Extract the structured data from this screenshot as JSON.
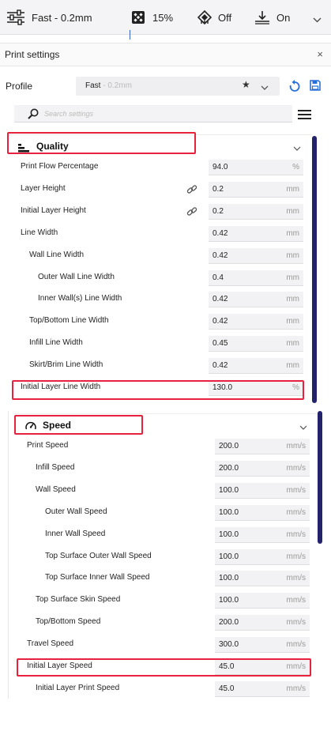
{
  "topbar": {
    "profile": "Fast - 0.2mm",
    "infill": "15%",
    "support": "Off",
    "adhesion": "On"
  },
  "print_settings": {
    "title": "Print settings",
    "close": "×",
    "profile_label": "Profile",
    "profile_name": "Fast",
    "profile_variant": " - 0.2mm",
    "search_placeholder": "Search settings"
  },
  "quality": {
    "title": "Quality",
    "rows": [
      {
        "label": "Print Flow Percentage",
        "value": "94.0",
        "unit": "%"
      },
      {
        "label": "Layer Height",
        "value": "0.2",
        "unit": "mm"
      },
      {
        "label": "Initial Layer Height",
        "value": "0.2",
        "unit": "mm"
      },
      {
        "label": "Line Width",
        "value": "0.42",
        "unit": "mm"
      },
      {
        "label": "Wall Line Width",
        "value": "0.42",
        "unit": "mm"
      },
      {
        "label": "Outer Wall Line Width",
        "value": "0.4",
        "unit": "mm"
      },
      {
        "label": "Inner Wall(s) Line Width",
        "value": "0.42",
        "unit": "mm"
      },
      {
        "label": "Top/Bottom Line Width",
        "value": "0.42",
        "unit": "mm"
      },
      {
        "label": "Infill Line Width",
        "value": "0.45",
        "unit": "mm"
      },
      {
        "label": "Skirt/Brim Line Width",
        "value": "0.42",
        "unit": "mm"
      },
      {
        "label": "Initial Layer Line Width",
        "value": "130.0",
        "unit": "%"
      }
    ]
  },
  "speed": {
    "title": "Speed",
    "rows": [
      {
        "label": "Print Speed",
        "value": "200.0",
        "unit": "mm/s"
      },
      {
        "label": "Infill Speed",
        "value": "200.0",
        "unit": "mm/s"
      },
      {
        "label": "Wall Speed",
        "value": "100.0",
        "unit": "mm/s"
      },
      {
        "label": "Outer Wall Speed",
        "value": "100.0",
        "unit": "mm/s"
      },
      {
        "label": "Inner Wall Speed",
        "value": "100.0",
        "unit": "mm/s"
      },
      {
        "label": "Top Surface Outer Wall Speed",
        "value": "100.0",
        "unit": "mm/s"
      },
      {
        "label": "Top Surface Inner Wall Speed",
        "value": "100.0",
        "unit": "mm/s"
      },
      {
        "label": "Top Surface Skin Speed",
        "value": "100.0",
        "unit": "mm/s"
      },
      {
        "label": "Top/Bottom Speed",
        "value": "200.0",
        "unit": "mm/s"
      },
      {
        "label": "Travel Speed",
        "value": "300.0",
        "unit": "mm/s"
      },
      {
        "label": "Initial Layer Speed",
        "value": "45.0",
        "unit": "mm/s"
      },
      {
        "label": "Initial Layer Print Speed",
        "value": "45.0",
        "unit": "mm/s"
      }
    ]
  },
  "colors": {
    "highlight": "#e8213e",
    "accent": "#2b6fd6",
    "scrollbar": "#23236b"
  }
}
